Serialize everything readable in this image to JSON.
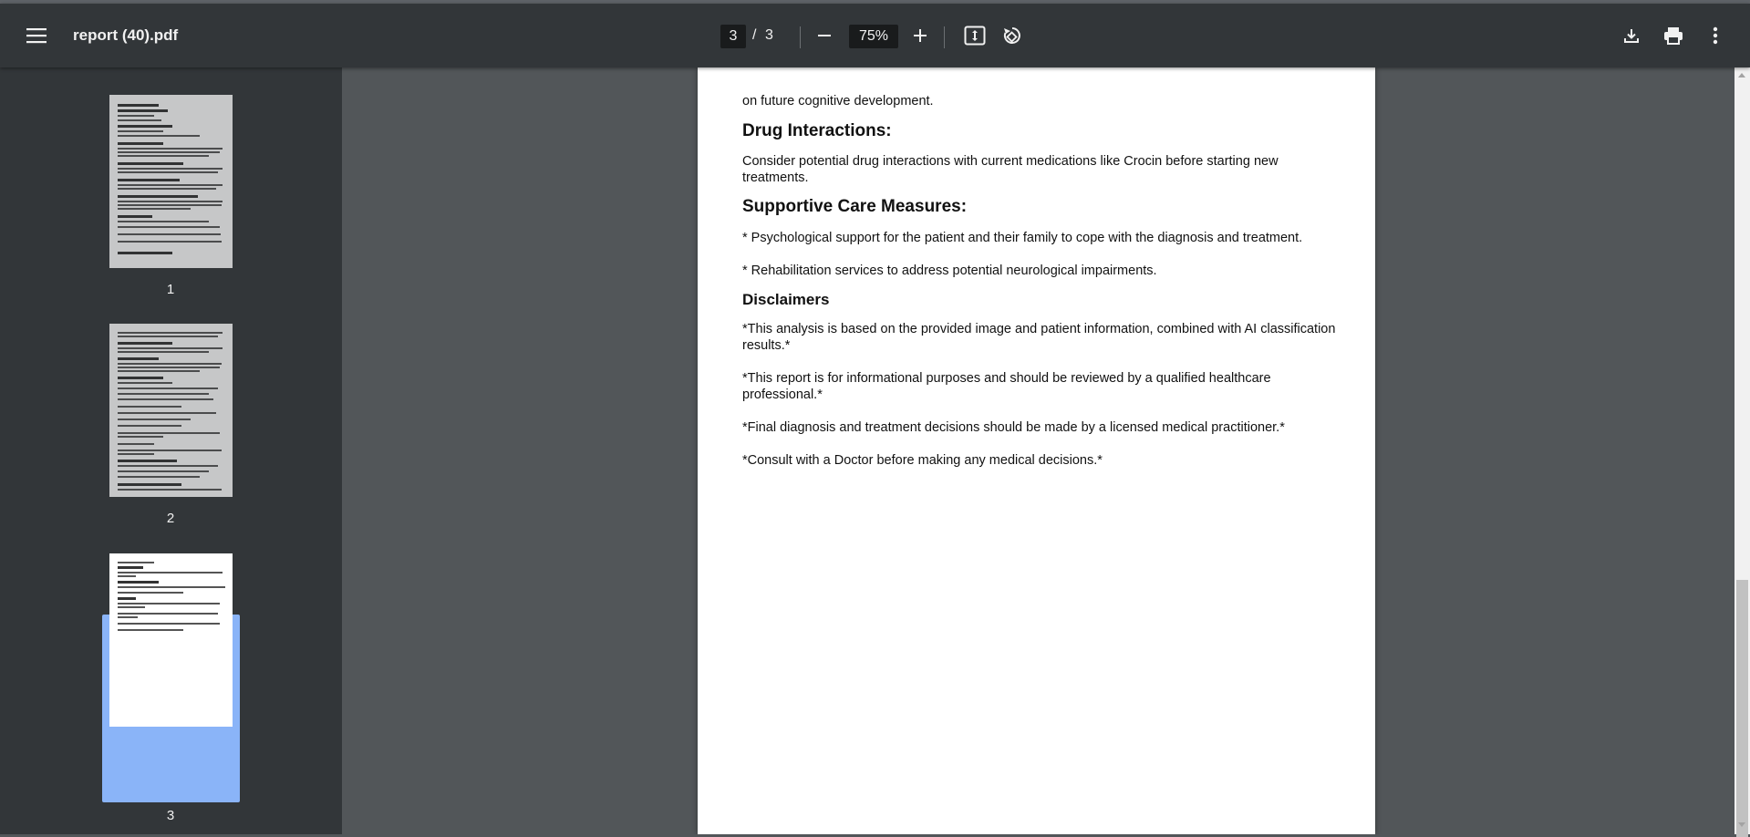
{
  "toolbar": {
    "title": "report (40).pdf",
    "current_page": "3",
    "page_separator": "/",
    "total_pages": "3",
    "zoom": "75%",
    "icons": [
      "menu-icon",
      "zoom-out-icon",
      "zoom-in-icon",
      "fit-page-icon",
      "rotate-icon",
      "download-icon",
      "print-icon",
      "more-vert-icon"
    ]
  },
  "sidebar": {
    "thumbnails": [
      {
        "number": "1"
      },
      {
        "number": "2"
      },
      {
        "number": "3",
        "selected": true
      }
    ]
  },
  "document": {
    "continued_text": "on future cognitive development.",
    "drug_heading": "Drug Interactions:",
    "drug_text": "Consider potential drug interactions with current medications like Crocin before starting new treatments.",
    "supportive_heading": "Supportive Care Measures:",
    "supportive_items": [
      "* Psychological support for the patient and their family to cope with the diagnosis and treatment.",
      "* Rehabilitation services to address potential neurological impairments."
    ],
    "disclaimers_heading": "Disclaimers",
    "disclaimers": [
      "*This analysis is based on the provided image and patient information, combined with AI classification results.*",
      "*This report is for informational purposes and should be reviewed by a qualified healthcare professional.*",
      "*Final diagnosis and treatment decisions should be made by a licensed medical practitioner.*",
      "*Consult with a Doctor before making any medical decisions.*"
    ]
  },
  "colors": {
    "toolbar_bg": "#323639",
    "viewer_bg": "#525659",
    "selection": "#8ab4f8"
  }
}
